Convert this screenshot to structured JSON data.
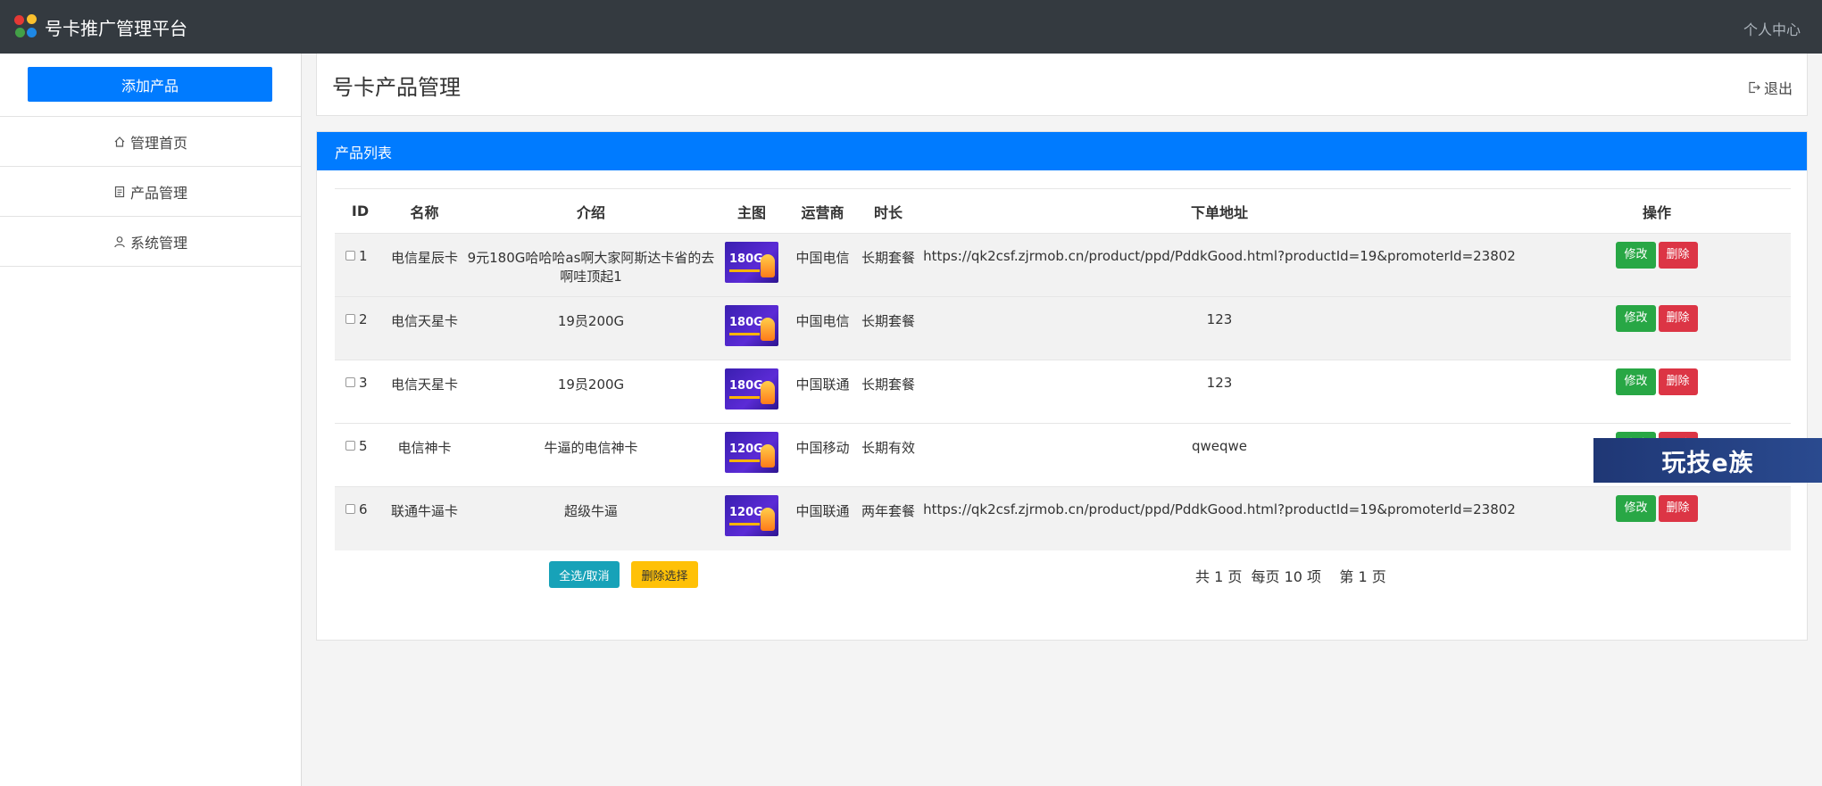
{
  "topbar": {
    "title": "号卡推广管理平台",
    "user_center": "个人中心"
  },
  "sidebar": {
    "add_button": "添加产品",
    "items": [
      {
        "label": "管理首页",
        "icon": "home-icon"
      },
      {
        "label": "产品管理",
        "icon": "document-icon"
      },
      {
        "label": "系统管理",
        "icon": "user-icon"
      }
    ]
  },
  "header": {
    "title": "号卡产品管理",
    "logout": "退出"
  },
  "list": {
    "title": "产品列表",
    "columns": [
      "ID",
      "名称",
      "介绍",
      "主图",
      "运营商",
      "时长",
      "下单地址",
      "操作"
    ],
    "rows": [
      {
        "id": "1",
        "name": "电信星辰卡",
        "intro": "9元180G哈哈哈as啊大家阿斯达卡省的去啊哇顶起1",
        "image_text": "180G",
        "carrier": "中国电信",
        "duration": "长期套餐",
        "url": "https://qk2csf.zjrmob.cn/product/ppd/PddkGood.html?productId=19&promoterId=23802"
      },
      {
        "id": "2",
        "name": "电信天星卡",
        "intro": "19员200G",
        "image_text": "180G",
        "carrier": "中国电信",
        "duration": "长期套餐",
        "url": "123"
      },
      {
        "id": "3",
        "name": "电信天星卡",
        "intro": "19员200G",
        "image_text": "180G",
        "carrier": "中国联通",
        "duration": "长期套餐",
        "url": "123"
      },
      {
        "id": "5",
        "name": "电信神卡",
        "intro": "牛逼的电信神卡",
        "image_text": "120G",
        "carrier": "中国移动",
        "duration": "长期有效",
        "url": "qweqwe"
      },
      {
        "id": "6",
        "name": "联通牛逼卡",
        "intro": "超级牛逼",
        "image_text": "120G",
        "carrier": "中国联通",
        "duration": "两年套餐",
        "url": "https://qk2csf.zjrmob.cn/product/ppd/PddkGood.html?productId=19&promoterId=23802"
      }
    ],
    "edit_label": "修改",
    "delete_label": "删除",
    "select_all": "全选/取消",
    "delete_selected": "删除选择",
    "pagination": "共 1 页  每页 10 项    第 1 页"
  },
  "watermark": "玩技e族",
  "colors": {
    "primary": "#007bff",
    "topbar": "#343a40",
    "success": "#28a745",
    "danger": "#dc3545",
    "info": "#17a2b8",
    "warning": "#ffc107"
  }
}
